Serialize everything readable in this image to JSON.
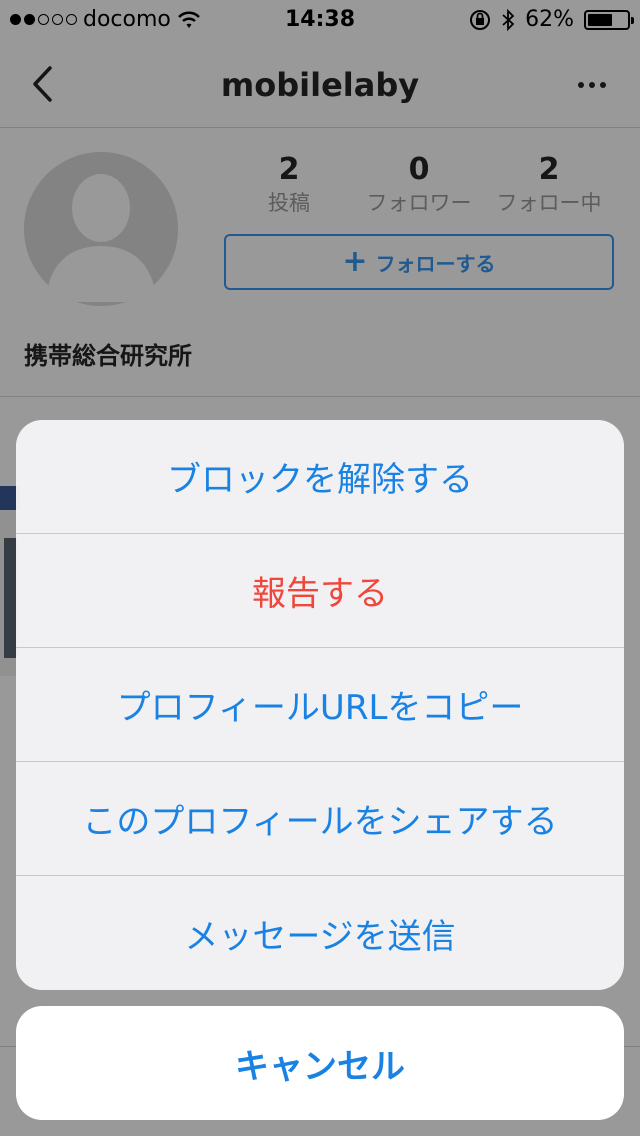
{
  "status_bar": {
    "carrier": "docomo",
    "time": "14:38",
    "battery_percent": "62%",
    "battery_level": 0.62,
    "signal_bars_filled": 2,
    "signal_bars_total": 5
  },
  "nav": {
    "title": "mobilelaby"
  },
  "profile": {
    "name": "携帯総合研究所",
    "stats": [
      {
        "value": "2",
        "label": "投稿"
      },
      {
        "value": "0",
        "label": "フォロワー"
      },
      {
        "value": "2",
        "label": "フォロー中"
      }
    ],
    "follow_button_label": "フォローする"
  },
  "action_sheet": {
    "items": [
      {
        "label": "ブロックを解除する",
        "style": "default"
      },
      {
        "label": "報告する",
        "style": "destructive"
      },
      {
        "label": "プロフィールURLをコピー",
        "style": "default"
      },
      {
        "label": "このプロフィールをシェアする",
        "style": "default"
      },
      {
        "label": "メッセージを送信",
        "style": "default"
      }
    ],
    "cancel_label": "キャンセル"
  },
  "colors": {
    "accent": "#1a82e2",
    "destructive": "#f0473d",
    "follow_blue": "#3897f0"
  }
}
